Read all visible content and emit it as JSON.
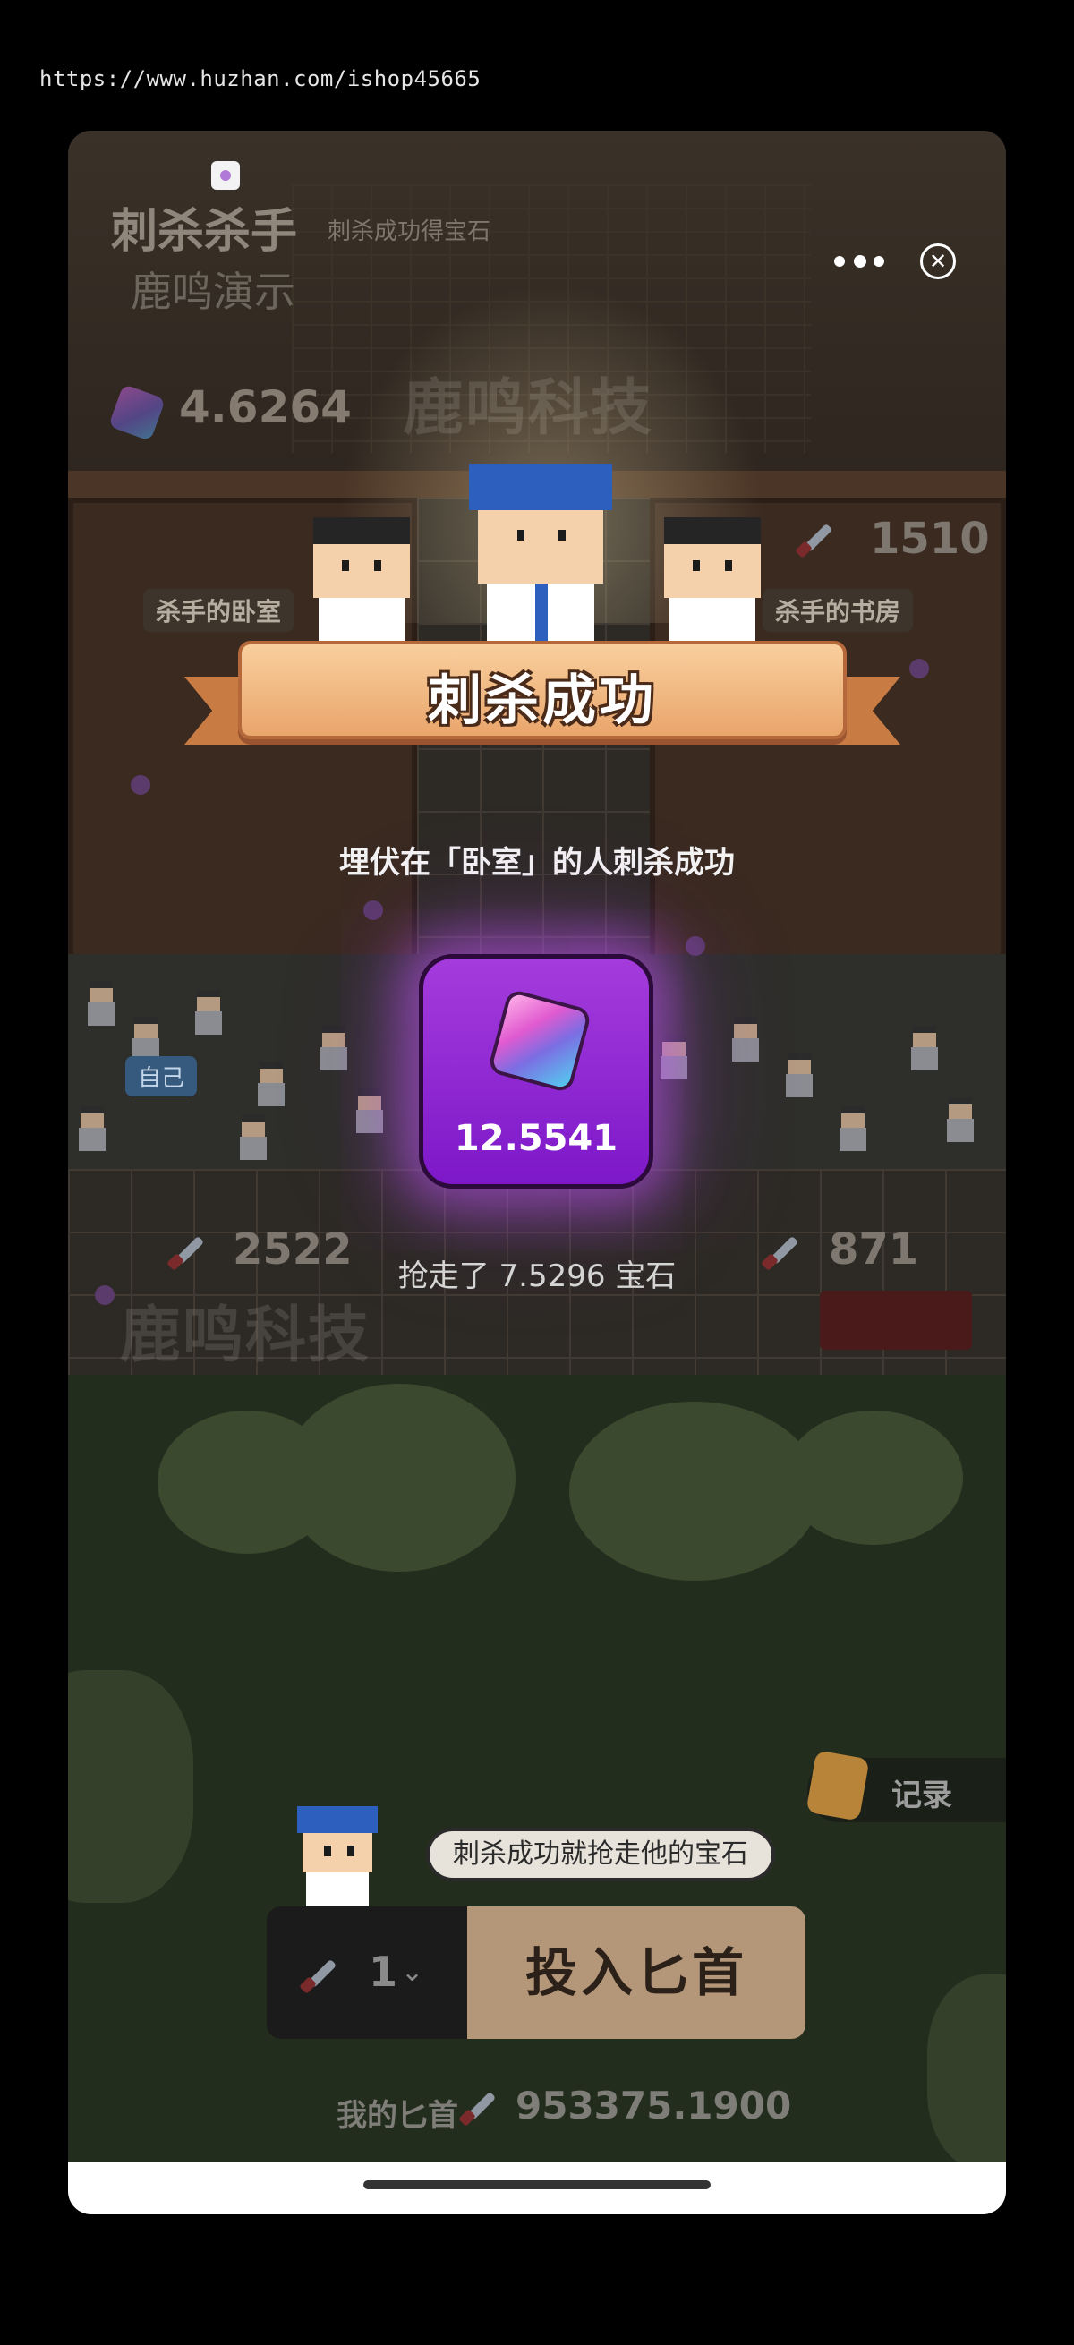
{
  "url": "https://www.huzhan.com/ishop45665",
  "header": {
    "title": "刺杀杀手",
    "subtitle": "刺杀成功得宝石",
    "demo_label": "鹿鸣演示"
  },
  "watermark": "鹿鸣科技",
  "balance": "4.6264",
  "rooms": {
    "bedroom_label": "杀手的卧室",
    "study_label": "杀手的书房",
    "top_right_count": "1510",
    "bottom_left_count": "2522",
    "bottom_right_count": "871",
    "self_badge": "自己"
  },
  "result": {
    "banner": "刺杀成功",
    "ambush_text": "埋伏在「卧室」的人刺杀成功",
    "gem_amount": "12.5541",
    "stolen_text": "抢走了 7.5296 宝石"
  },
  "records_label": "记录",
  "hint_bubble": "刺杀成功就抢走他的宝石",
  "controls": {
    "quantity": "1",
    "invest_label": "投入匕首",
    "my_dagger_label": "我的匕首",
    "my_dagger_value": "953375.1900"
  },
  "icons": [
    "mini-app-icon",
    "more-icon",
    "close-icon",
    "gem-icon",
    "knife-icon",
    "records-icon",
    "chevron-down-icon"
  ]
}
